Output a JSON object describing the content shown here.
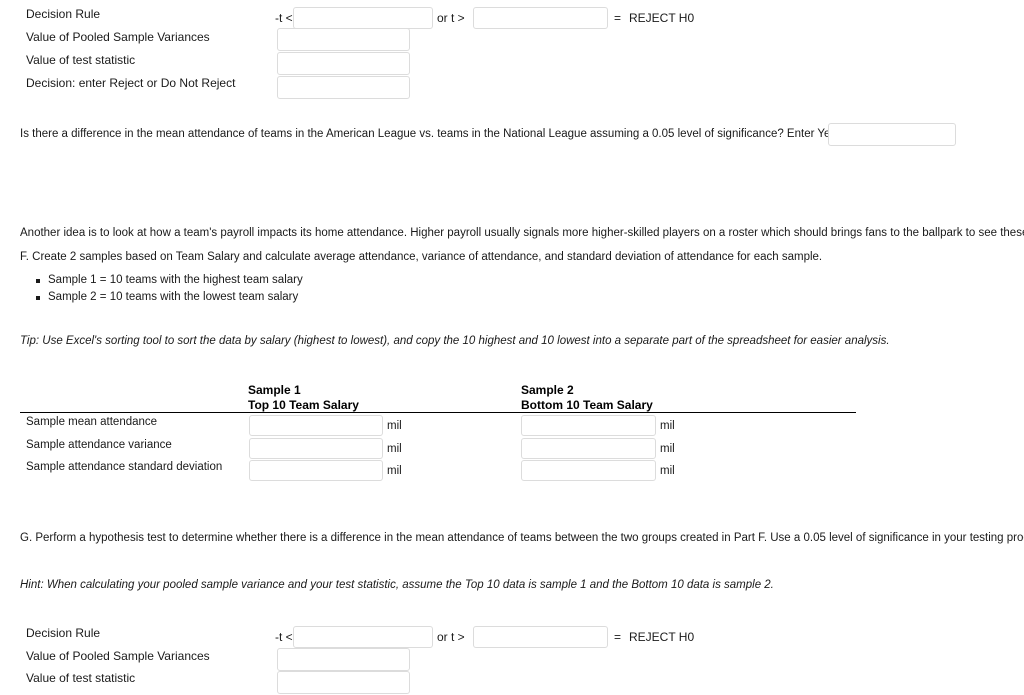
{
  "decision_block_top": {
    "rows": [
      {
        "label": "Decision Rule"
      },
      {
        "label": "Value of Pooled Sample Variances"
      },
      {
        "label": "Value of test statistic"
      },
      {
        "label": "Decision: enter Reject or Do Not Reject"
      }
    ],
    "op_minus_t": "-t <",
    "op_or_t": "or  t >",
    "op_equals": "=",
    "reject_text": "REJECT H0",
    "inputs": {
      "lower_bound": "",
      "upper_bound": "",
      "pooled_variance": "",
      "test_statistic": "",
      "decision": ""
    }
  },
  "question_e": {
    "text": "Is there a difference in the mean attendance of teams in the American League vs. teams in the National League assuming a 0.05 level of significance? Enter Yes or No.",
    "answer_value": ""
  },
  "intro_paragraph": "Another idea is to look at how a team's payroll impacts its home attendance. Higher payroll usually signals more higher-skilled players on a roster which should brings fans to the ballpark to see these players.",
  "part_f": {
    "instruction": "F. Create 2 samples based on Team Salary and calculate average attendance, variance of attendance, and standard deviation of attendance for each sample.",
    "bullets": [
      "Sample 1 = 10 teams with the highest team salary",
      "Sample 2 = 10 teams with the lowest team salary"
    ],
    "tip": "Tip: Use Excel's sorting tool to sort the data by salary (highest to lowest), and copy the 10 highest and 10 lowest into a separate part of the spreadsheet for easier analysis."
  },
  "sample_table": {
    "columns": [
      {
        "title": "Sample 1",
        "subtitle": "Top 10 Team Salary"
      },
      {
        "title": "Sample 2",
        "subtitle": "Bottom 10 Team Salary"
      }
    ],
    "rows": [
      {
        "label": "Sample mean attendance",
        "sample1": "",
        "sample2": "",
        "unit1": "mil",
        "unit2": "mil"
      },
      {
        "label": "Sample attendance  variance",
        "sample1": "",
        "sample2": "",
        "unit1": "mil",
        "unit2": "mil"
      },
      {
        "label": "Sample attendance standard deviation",
        "sample1": "",
        "sample2": "",
        "unit1": "mil",
        "unit2": "mil"
      }
    ]
  },
  "part_g": {
    "instruction": "G. Perform a hypothesis test to determine whether there is a difference in the mean attendance of teams between the two groups created in Part F. Use a 0.05 level of significance in your testing procedures.",
    "hint": "Hint: When calculating your pooled sample variance and your test statistic, assume the Top 10 data is sample 1 and the Bottom 10 data is sample 2."
  },
  "decision_block_bottom": {
    "rows": [
      {
        "label": "Decision Rule"
      },
      {
        "label": "Value of Pooled Sample Variances"
      },
      {
        "label": "Value of test statistic"
      }
    ],
    "op_minus_t": "-t <",
    "op_or_t": "or  t >",
    "op_equals": "=",
    "reject_text": "REJECT H0",
    "inputs": {
      "lower_bound": "",
      "upper_bound": "",
      "pooled_variance": "",
      "test_statistic": ""
    }
  },
  "colors": {
    "text": "#1a1a1a",
    "input_border": "#dcdcdc",
    "rule": "#000000",
    "background": "#ffffff"
  }
}
